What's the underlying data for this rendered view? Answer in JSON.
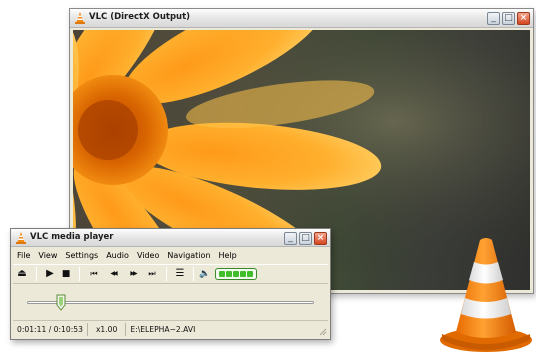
{
  "video_window": {
    "title": "VLC (DirectX Output)",
    "buttons": {
      "minimize": "_",
      "maximize": "□",
      "close": "×"
    }
  },
  "player_window": {
    "title": "VLC media player",
    "buttons": {
      "minimize": "_",
      "maximize": "□",
      "close": "×"
    },
    "menu": [
      "File",
      "View",
      "Settings",
      "Audio",
      "Video",
      "Navigation",
      "Help"
    ],
    "toolbar": {
      "eject": "⏏",
      "play": "▶",
      "stop": "■",
      "previous": "⏮",
      "rewind": "◀◀",
      "fast_forward": "▶▶",
      "next": "⏭",
      "playlist": "☰",
      "speaker": "🔈"
    },
    "volume_level": 1.0,
    "seek_progress": 0.1176,
    "status": {
      "time": "0:01:11 / 0:10:53",
      "speed": "x1.00",
      "file": "E:\\ELEPHA~2.AVI"
    }
  },
  "colors": {
    "accent_orange": "#ff8a00",
    "close_button": "#d4461f",
    "volume_green": "#3fbd2b"
  }
}
